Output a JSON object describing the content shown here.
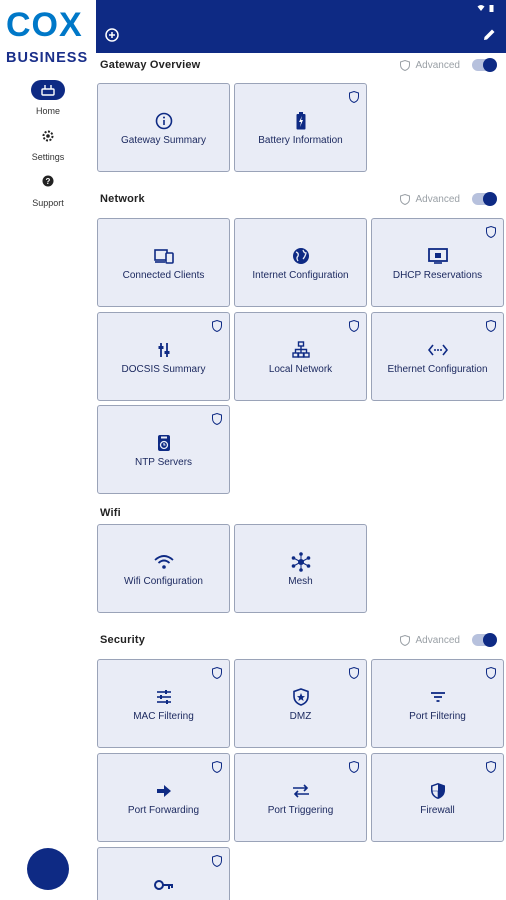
{
  "brand": {
    "line1": "COX",
    "line2": "BUSINESS"
  },
  "nav": [
    {
      "label": "Home",
      "icon": "router-icon",
      "active": true
    },
    {
      "label": "Settings",
      "icon": "gear-icon",
      "active": false
    },
    {
      "label": "Support",
      "icon": "help-icon",
      "active": false
    }
  ],
  "advanced_label": "Advanced",
  "sections": {
    "gateway": {
      "title": "Gateway Overview",
      "tiles": [
        "Gateway Summary",
        "Battery Information"
      ]
    },
    "network": {
      "title": "Network",
      "tiles": [
        "Connected Clients",
        "Internet Configuration",
        "DHCP Reservations",
        "DOCSIS Summary",
        "Local Network",
        "Ethernet Configuration",
        "NTP Servers"
      ]
    },
    "wifi": {
      "title": "Wifi",
      "tiles": [
        "Wifi Configuration",
        "Mesh"
      ]
    },
    "security": {
      "title": "Security",
      "tiles": [
        "MAC Filtering",
        "DMZ",
        "Port Filtering",
        "Port Forwarding",
        "Port Triggering",
        "Firewall",
        ""
      ]
    }
  },
  "colors": {
    "primary": "#0e2a84",
    "tile_bg": "#e9ecf6",
    "brand_blue": "#0078c8"
  }
}
